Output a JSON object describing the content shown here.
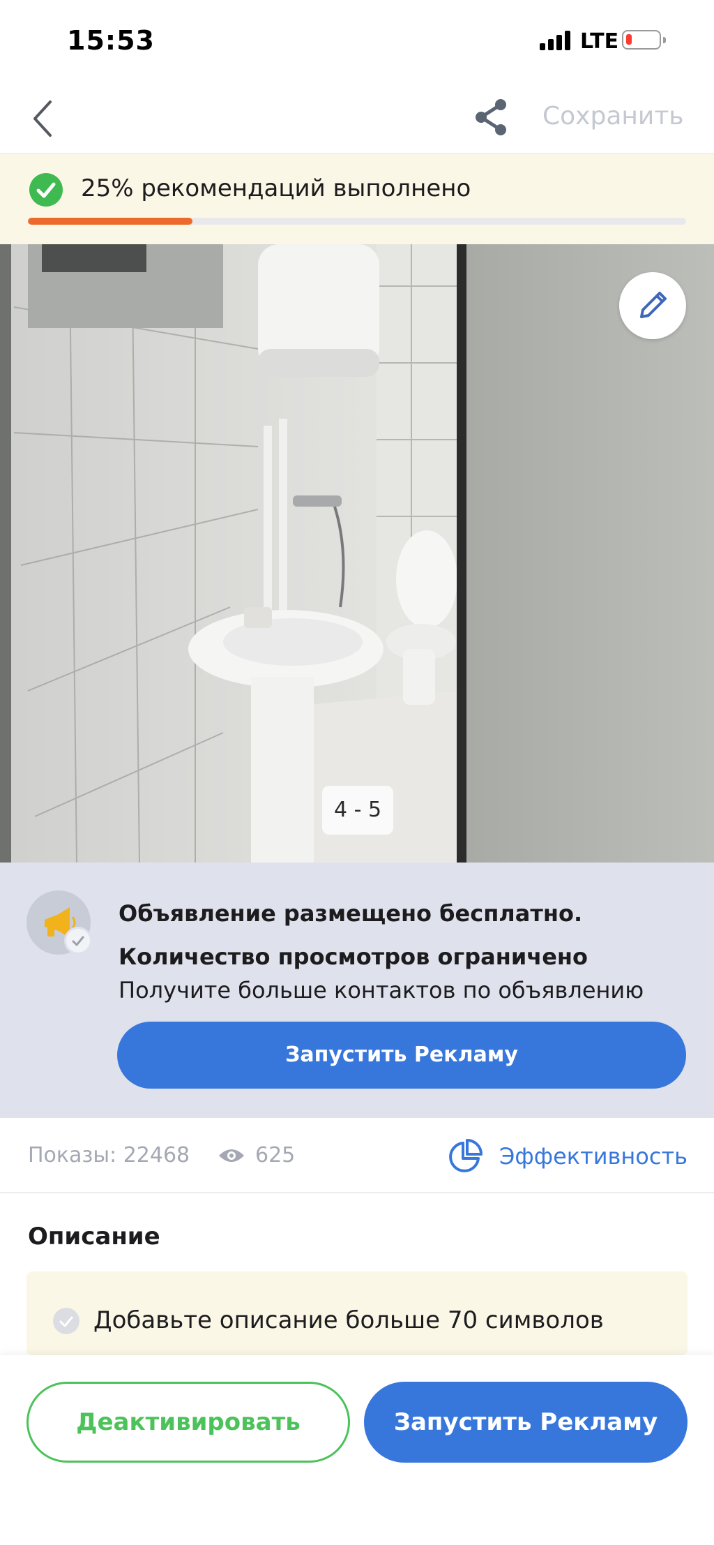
{
  "status_bar": {
    "time": "15:53",
    "network": "LTE"
  },
  "nav": {
    "save_label": "Сохранить"
  },
  "recommendations": {
    "text": "25% рекомендаций выполнено",
    "progress": 0.25
  },
  "photo": {
    "counter": "4 - 5"
  },
  "promo": {
    "title_line1": "Объявление размещено бесплатно.",
    "title_line2": "Количество просмотров ограничено",
    "subtitle": "Получите больше контактов по объявлению",
    "button_label": "Запустить Рекламу"
  },
  "stats": {
    "impressions_label": "Показы: 22468",
    "views": "625",
    "efficiency_label": "Эффективность"
  },
  "description": {
    "title": "Описание",
    "tip": "Добавьте описание больше 70 символов"
  },
  "bottom_bar": {
    "deactivate_label": "Деактивировать",
    "launch_label": "Запустить Рекламу"
  },
  "colors": {
    "accent_blue": "#3777dc",
    "success_green": "#4cc25a",
    "progress_orange": "#ec6a2b",
    "banner_yellow": "#fbf7e7",
    "promo_bg": "#dfe1ec"
  },
  "icons": [
    "back-chevron-icon",
    "share-icon",
    "check-circle-icon",
    "pencil-icon",
    "megaphone-icon",
    "eye-icon",
    "pie-chart-icon"
  ]
}
